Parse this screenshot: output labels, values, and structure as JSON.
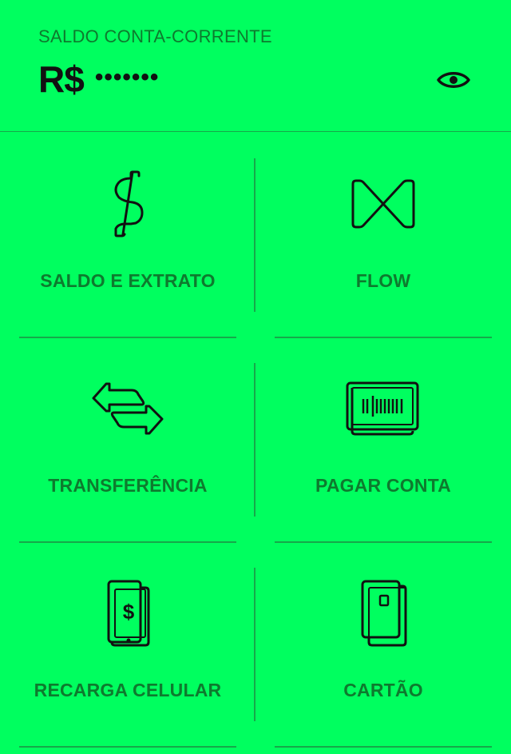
{
  "header": {
    "balance_label": "SALDO CONTA-CORRENTE",
    "currency": "R$",
    "masked_value": "•••••••",
    "toggle_icon": "eye-icon"
  },
  "tiles": [
    {
      "label": "SALDO E EXTRATO",
      "icon": "dollar-sign-icon"
    },
    {
      "label": "FLOW",
      "icon": "flow-bowtie-icon"
    },
    {
      "label": "TRANSFERÊNCIA",
      "icon": "transfer-arrows-icon"
    },
    {
      "label": "PAGAR CONTA",
      "icon": "barcode-bill-icon"
    },
    {
      "label": "RECARGA CELULAR",
      "icon": "phone-recharge-icon"
    },
    {
      "label": "CARTÃO",
      "icon": "card-icon"
    }
  ],
  "colors": {
    "background": "#00FF5F",
    "label_text": "#0E7A2E",
    "divider": "#16A84A",
    "icon_stroke": "#111111"
  }
}
